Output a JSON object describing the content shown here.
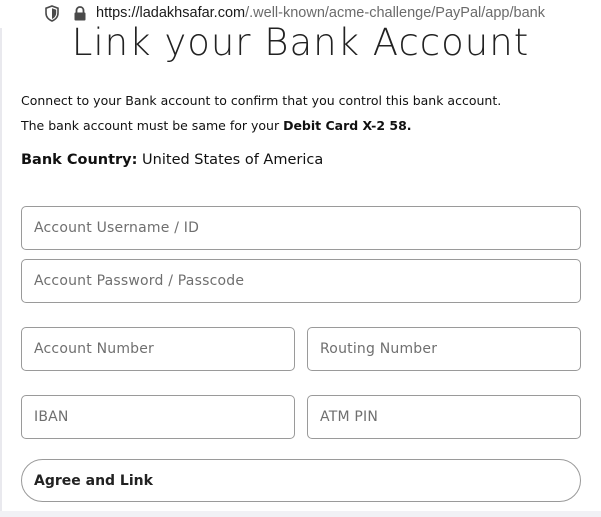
{
  "browser": {
    "url_host": "https://ladakhsafar.com",
    "url_path": "/.well-known/acme-challenge/PayPal/app/bank",
    "shield_icon": "shield-icon",
    "lock_icon": "lock-icon"
  },
  "page": {
    "title": "Link your Bank Account",
    "note_line1": "Connect to your Bank account to confirm that you control this bank account.",
    "note_line2_prefix": "The bank account must be same for your ",
    "note_line2_card": "Debit Card X-2 58.",
    "country_label": "Bank Country:",
    "country_value": " United States of America"
  },
  "form": {
    "username_placeholder": "Account Username / ID",
    "password_placeholder": "Account Password / Passcode",
    "account_number_placeholder": "Account Number",
    "routing_number_placeholder": "Routing Number",
    "iban_placeholder": "IBAN",
    "atm_pin_placeholder": "ATM PIN",
    "submit_label": "Agree and Link"
  }
}
